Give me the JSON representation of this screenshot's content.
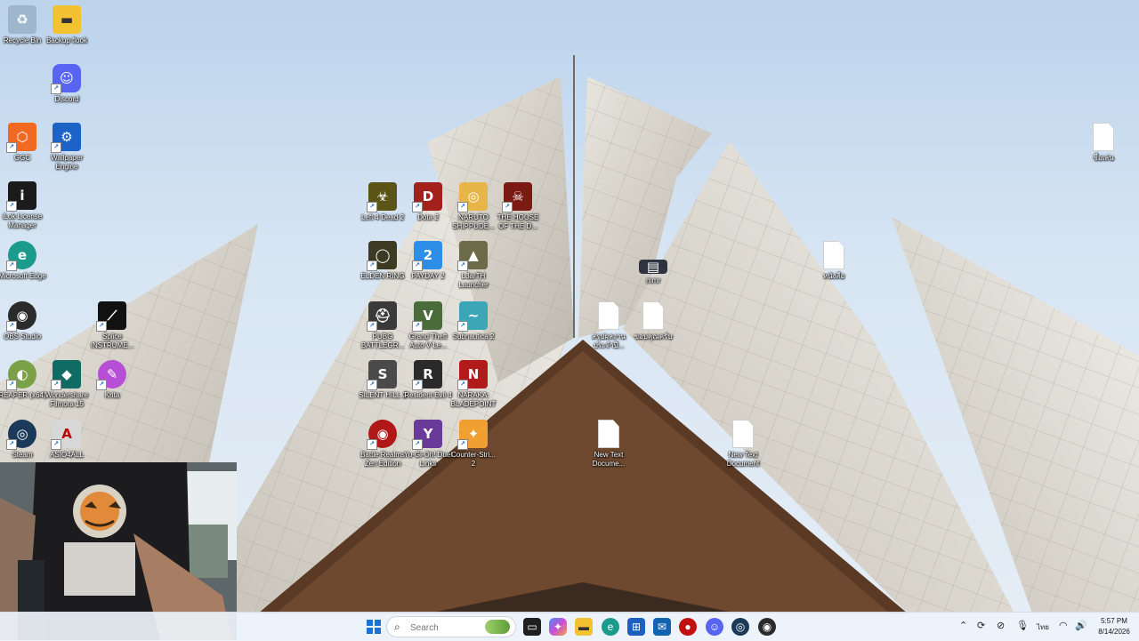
{
  "desktop_icons": [
    {
      "id": "recycle",
      "label": "Recycle Bin",
      "color": "#9fb7cc",
      "glyph": "♻"
    },
    {
      "id": "backup",
      "label": "Backup flook",
      "color": "#f2c230",
      "glyph": "▬"
    },
    {
      "id": "discord",
      "label": "Discord",
      "color": "#5865F2",
      "glyph": "☺"
    },
    {
      "id": "ggc",
      "label": "GGC",
      "color": "#f26a21",
      "glyph": "⬡"
    },
    {
      "id": "wallpaper",
      "label": "Wallpaper Engine",
      "color": "#1d63c7",
      "glyph": "⚙"
    },
    {
      "id": "ilok",
      "label": "iLok License Manager",
      "color": "#1b1b1b",
      "glyph": "i"
    },
    {
      "id": "edge",
      "label": "Microsoft Edge",
      "color": "#1a9b8c",
      "glyph": "e"
    },
    {
      "id": "obs",
      "label": "OBS Studio",
      "color": "#2b2b2b",
      "glyph": "◉"
    },
    {
      "id": "splice",
      "label": "Splice INSTRUME...",
      "color": "#111",
      "glyph": "⟋"
    },
    {
      "id": "reaper",
      "label": "REAPER (x64)",
      "color": "#7aa145",
      "glyph": "◐"
    },
    {
      "id": "filmora",
      "label": "Wondershare Filmora 15",
      "color": "#0f6b64",
      "glyph": "◆"
    },
    {
      "id": "krita",
      "label": "Krita",
      "color": "#b74fd6",
      "glyph": "✎"
    },
    {
      "id": "steam",
      "label": "Steam",
      "color": "#1b3a5a",
      "glyph": "◎"
    },
    {
      "id": "asio",
      "label": "ASIO4ALL",
      "color": "#d7d7d7",
      "glyph": "A"
    },
    {
      "id": "l4d2",
      "label": "Left 4 Dead 2",
      "color": "#5a5416",
      "glyph": "☣"
    },
    {
      "id": "dota2",
      "label": "Dota 2",
      "color": "#a3201b",
      "glyph": "D"
    },
    {
      "id": "naruto",
      "label": "NARUTO SHIPPUDE...",
      "color": "#e7b548",
      "glyph": "◎"
    },
    {
      "id": "houseofdead",
      "label": "THE HOUSE OF THE D...",
      "color": "#7a1a12",
      "glyph": "☠"
    },
    {
      "id": "eldenring",
      "label": "ELDEN RING",
      "color": "#3d3a24",
      "glyph": "◯"
    },
    {
      "id": "payday2",
      "label": "PAYDAY 2",
      "color": "#2c8ee6",
      "glyph": "2"
    },
    {
      "id": "launcher",
      "label": "L3arTH Launcher",
      "color": "#6b6b4a",
      "glyph": "▲"
    },
    {
      "id": "pubg",
      "label": "PUBG BATTLEGR...",
      "color": "#3a3a3a",
      "glyph": "⛑"
    },
    {
      "id": "gta5",
      "label": "Grand Theft Auto V Le...",
      "color": "#4a6b3a",
      "glyph": "V"
    },
    {
      "id": "subnautica2",
      "label": "Subnautica 2",
      "color": "#3aa6b8",
      "glyph": "~"
    },
    {
      "id": "silenthill2",
      "label": "SILENT HILL 2",
      "color": "#4a4a4a",
      "glyph": "S"
    },
    {
      "id": "residentevil4",
      "label": "Resident Evil 4",
      "color": "#2a2a2a",
      "glyph": "R"
    },
    {
      "id": "naraka",
      "label": "NARAKA: BLADEPOINT",
      "color": "#b11b1b",
      "glyph": "N"
    },
    {
      "id": "battlerealms",
      "label": "Battle Realms Zen Edition",
      "color": "#b01818",
      "glyph": "◉"
    },
    {
      "id": "yugioh",
      "label": "Yu-Gi-Oh! Duel Links",
      "color": "#6a3a9a",
      "glyph": "Y"
    },
    {
      "id": "cs2",
      "label": "Counter-Stri... 2",
      "color": "#f0a030",
      "glyph": "✦"
    },
    {
      "id": "mmr",
      "label": "mmr",
      "color": "#2d3440",
      "glyph": "▤"
    },
    {
      "id": "newtext1",
      "label": "New Text Docume...",
      "file": true
    },
    {
      "id": "newtext2",
      "label": "New Text Document",
      "file": true
    },
    {
      "id": "thaifile1",
      "label": "สรุปผลงานประจำปี...",
      "file": true
    },
    {
      "id": "thaifile2",
      "label": "ขอบคุณครับ",
      "file": true
    },
    {
      "id": "thaifile3",
      "label": "หนังสือ",
      "file": true
    },
    {
      "id": "thaifile4",
      "label": "ชื่อเล่น",
      "file": true
    }
  ],
  "taskbar": {
    "search_placeholder": "Search",
    "apps": [
      "start",
      "widgets",
      "task-view",
      "copilot",
      "file-explorer",
      "edge",
      "store",
      "outlook",
      "record",
      "discord",
      "steam",
      "obs"
    ],
    "tray": {
      "lang": "ไทย",
      "time": "5:57 PM",
      "date": "8/14/2026"
    }
  }
}
